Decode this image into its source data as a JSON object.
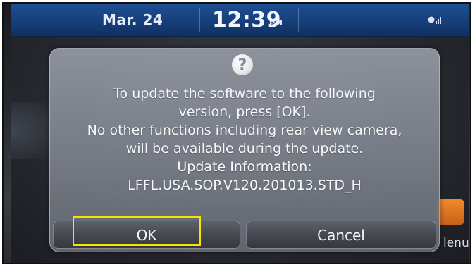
{
  "status_bar": {
    "date": "Mar. 24",
    "time": "12:39",
    "ampm": "PM",
    "signal_icon": "signal-icon"
  },
  "dialog": {
    "icon": "question-icon",
    "icon_glyph": "?",
    "lines": [
      "To update the software to the following",
      "version, press [OK].",
      "No other functions including rear view camera,",
      "will be available during the update.",
      "Update Information:",
      "LFFL.USA.SOP.V120.201013.STD_H"
    ],
    "ok_label": "OK",
    "cancel_label": "Cancel"
  },
  "background": {
    "menu_label": "lenu"
  },
  "colors": {
    "status_bar": "#163f7b",
    "highlight": "#f2e600",
    "menu_tile": "#e07a24"
  }
}
